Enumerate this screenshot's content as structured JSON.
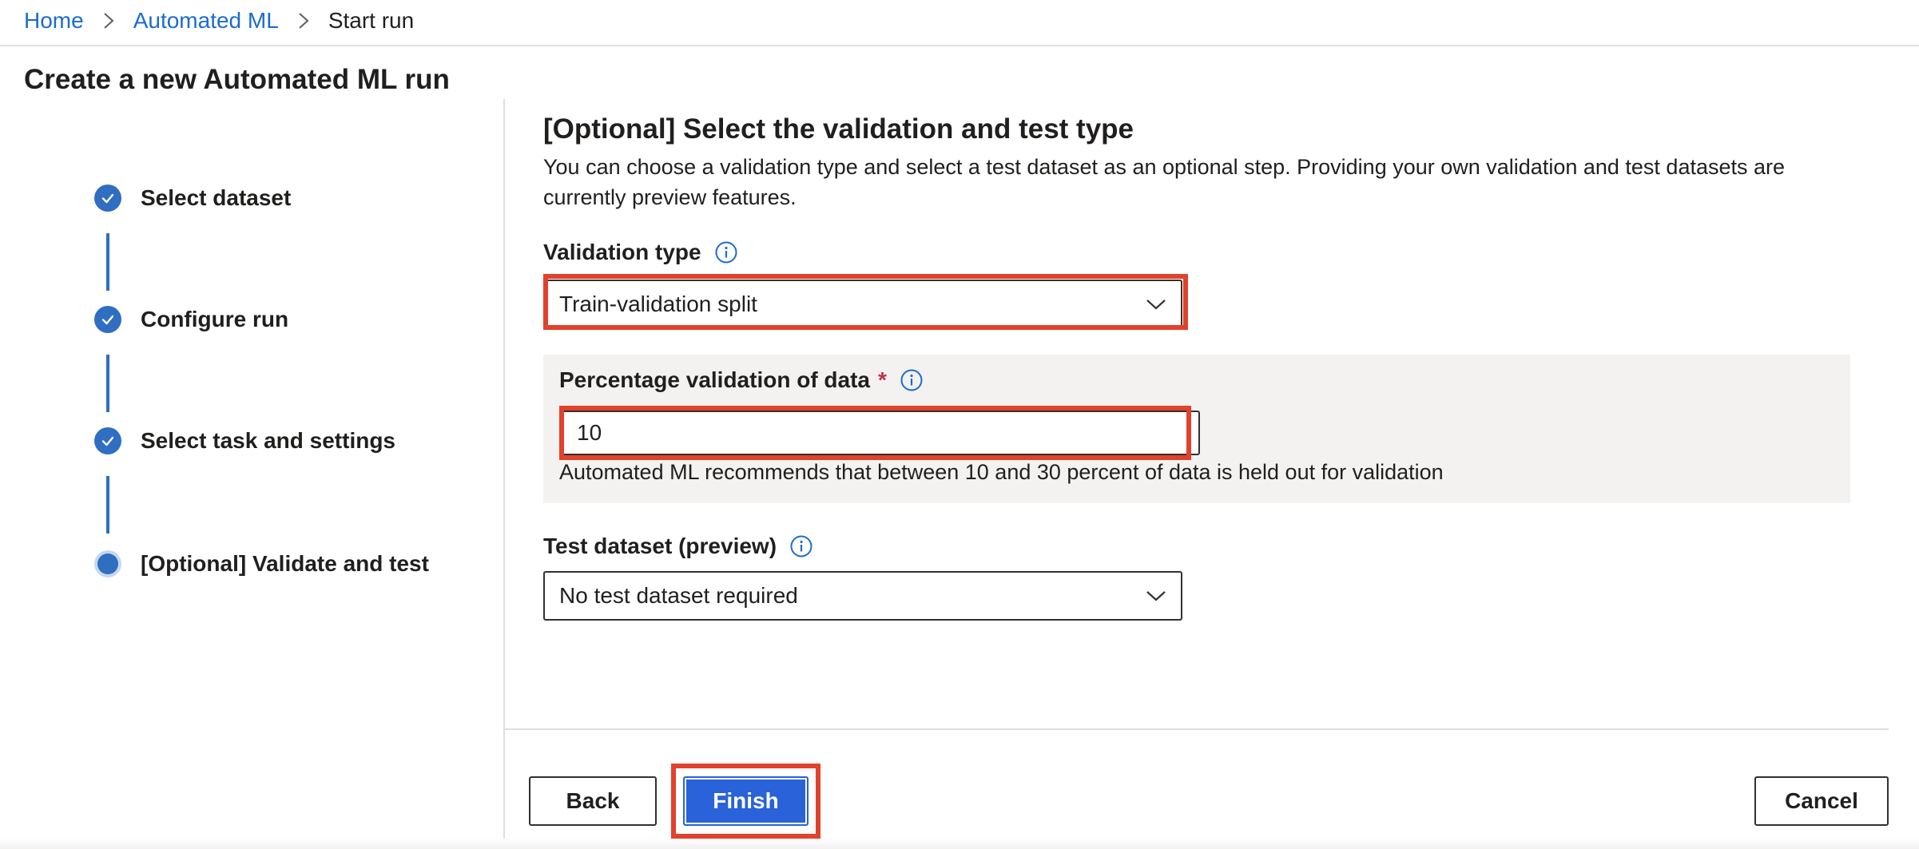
{
  "breadcrumb": {
    "items": [
      {
        "label": "Home",
        "link": true
      },
      {
        "label": "Automated ML",
        "link": true
      },
      {
        "label": "Start run",
        "link": false
      }
    ]
  },
  "page": {
    "title": "Create a new Automated ML run"
  },
  "stepper": {
    "steps": [
      {
        "label": "Select dataset",
        "state": "done"
      },
      {
        "label": "Configure run",
        "state": "done"
      },
      {
        "label": "Select task and settings",
        "state": "done"
      },
      {
        "label": "[Optional] Validate and test",
        "state": "current"
      }
    ]
  },
  "section": {
    "title": "[Optional] Select the validation and test type",
    "description": "You can choose a validation type and select a test dataset as an optional step. Providing your own validation and test datasets are currently preview features."
  },
  "validation_type": {
    "label": "Validation type",
    "value": "Train-validation split"
  },
  "percentage_validation": {
    "label": "Percentage validation of data",
    "required_marker": "*",
    "value": "10",
    "hint": "Automated ML recommends that between 10 and 30 percent of data is held out for validation"
  },
  "test_dataset": {
    "label": "Test dataset (preview)",
    "value": "No test dataset required"
  },
  "footer": {
    "back_label": "Back",
    "finish_label": "Finish",
    "cancel_label": "Cancel"
  },
  "colors": {
    "accent": "#2f6ec1",
    "primary_button": "#2962d9",
    "link": "#1b6bcf",
    "highlight": "#e2412b",
    "required": "#c4314b"
  },
  "icons": {
    "breadcrumb_separator": "chevron-right-icon",
    "step_done": "checkmark-icon",
    "info": "info-icon",
    "dropdown": "chevron-down-icon"
  }
}
